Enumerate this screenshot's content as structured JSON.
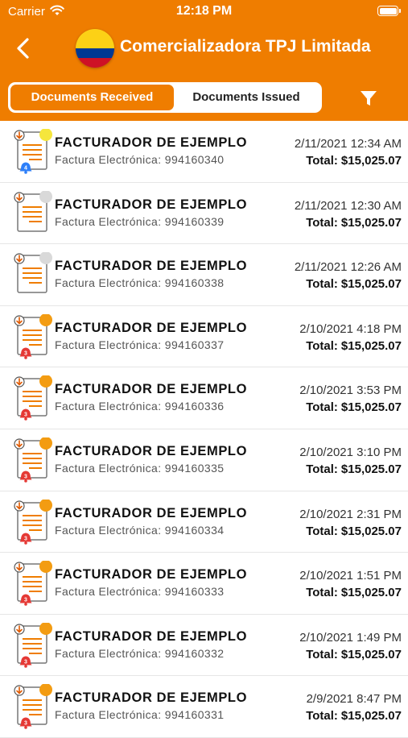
{
  "status_bar": {
    "carrier": "Carrier",
    "time": "12:18 PM"
  },
  "header": {
    "title": "Comercializadora TPJ Limitada",
    "bg_color": "#ef7d00"
  },
  "tabs": {
    "received": "Documents Received",
    "issued": "Documents Issued",
    "selected": "received"
  },
  "total_label": "Total:",
  "documents": [
    {
      "issuer": "FACTURADOR DE EJEMPLO",
      "invoice": "Factura Electrónica: 994160340",
      "date": "2/11/2021 12:34 AM",
      "total": "$15,025.07",
      "status_color": "#f5e63c",
      "bell": "blue",
      "bell_number": "4"
    },
    {
      "issuer": "FACTURADOR DE EJEMPLO",
      "invoice": "Factura Electrónica: 994160339",
      "date": "2/11/2021 12:30 AM",
      "total": "$15,025.07",
      "status_color": "#d9d9d9",
      "bell": "",
      "bell_number": ""
    },
    {
      "issuer": "FACTURADOR DE EJEMPLO",
      "invoice": "Factura Electrónica: 994160338",
      "date": "2/11/2021 12:26 AM",
      "total": "$15,025.07",
      "status_color": "#d9d9d9",
      "bell": "",
      "bell_number": ""
    },
    {
      "issuer": "FACTURADOR DE EJEMPLO",
      "invoice": "Factura Electrónica: 994160337",
      "date": "2/10/2021 4:18 PM",
      "total": "$15,025.07",
      "status_color": "#f39c12",
      "bell": "red",
      "bell_number": "3"
    },
    {
      "issuer": "FACTURADOR DE EJEMPLO",
      "invoice": "Factura Electrónica: 994160336",
      "date": "2/10/2021 3:53 PM",
      "total": "$15,025.07",
      "status_color": "#f39c12",
      "bell": "red",
      "bell_number": "3"
    },
    {
      "issuer": "FACTURADOR DE EJEMPLO",
      "invoice": "Factura Electrónica: 994160335",
      "date": "2/10/2021 3:10 PM",
      "total": "$15,025.07",
      "status_color": "#f39c12",
      "bell": "red",
      "bell_number": "3"
    },
    {
      "issuer": "FACTURADOR DE EJEMPLO",
      "invoice": "Factura Electrónica: 994160334",
      "date": "2/10/2021 2:31 PM",
      "total": "$15,025.07",
      "status_color": "#f39c12",
      "bell": "red",
      "bell_number": "3"
    },
    {
      "issuer": "FACTURADOR DE EJEMPLO",
      "invoice": "Factura Electrónica: 994160333",
      "date": "2/10/2021 1:51 PM",
      "total": "$15,025.07",
      "status_color": "#f39c12",
      "bell": "red",
      "bell_number": "3"
    },
    {
      "issuer": "FACTURADOR DE EJEMPLO",
      "invoice": "Factura Electrónica: 994160332",
      "date": "2/10/2021 1:49 PM",
      "total": "$15,025.07",
      "status_color": "#f39c12",
      "bell": "red",
      "bell_number": "3"
    },
    {
      "issuer": "FACTURADOR DE EJEMPLO",
      "invoice": "Factura Electrónica: 994160331",
      "date": "2/9/2021 8:47 PM",
      "total": "$15,025.07",
      "status_color": "#f39c12",
      "bell": "red",
      "bell_number": "3"
    }
  ]
}
